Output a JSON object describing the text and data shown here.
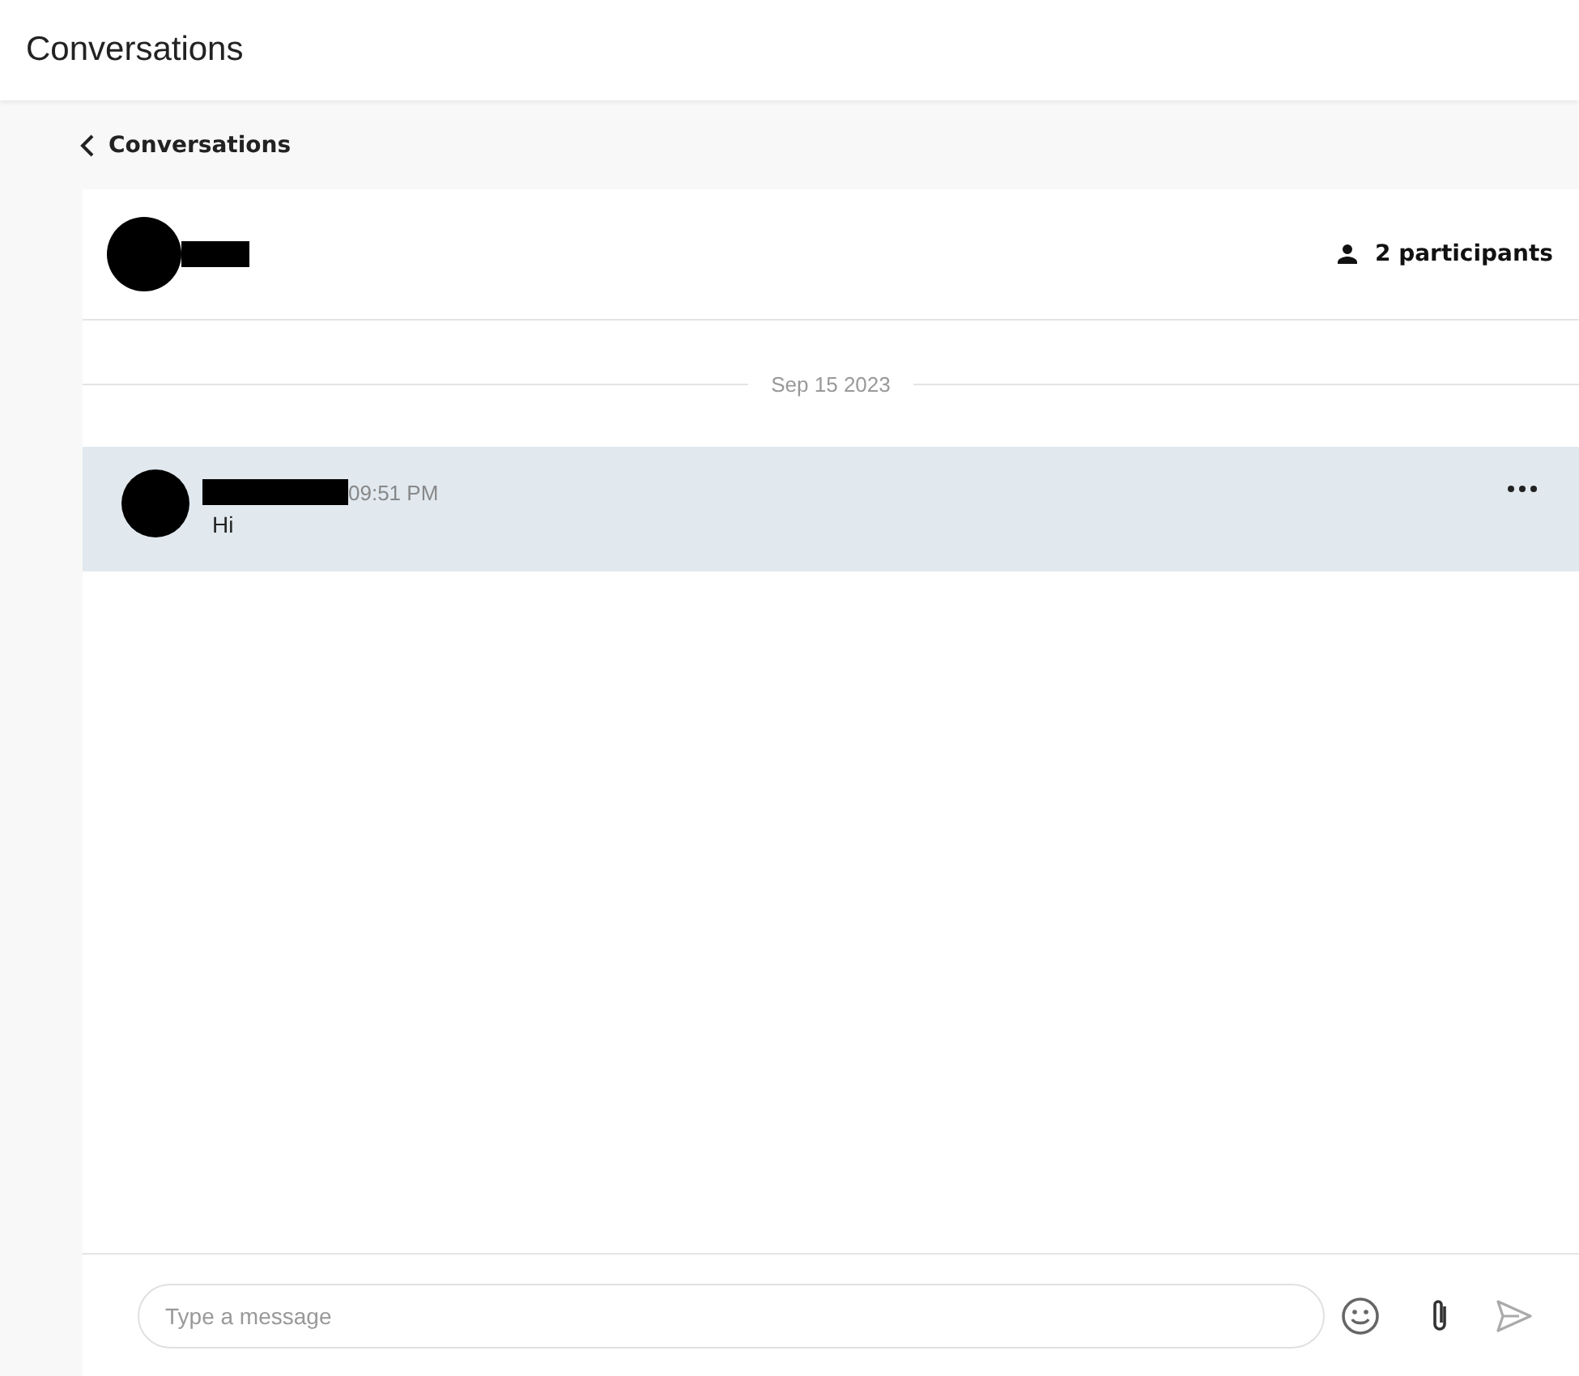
{
  "header": {
    "title": "Conversations"
  },
  "back_link": {
    "label": "Conversations"
  },
  "conversation": {
    "participants": "2 participants",
    "date": "Sep 15 2023",
    "messages": [
      {
        "time": "09:51 PM",
        "text": "Hi",
        "selected": true
      }
    ]
  },
  "composer": {
    "placeholder": "Type a message"
  }
}
